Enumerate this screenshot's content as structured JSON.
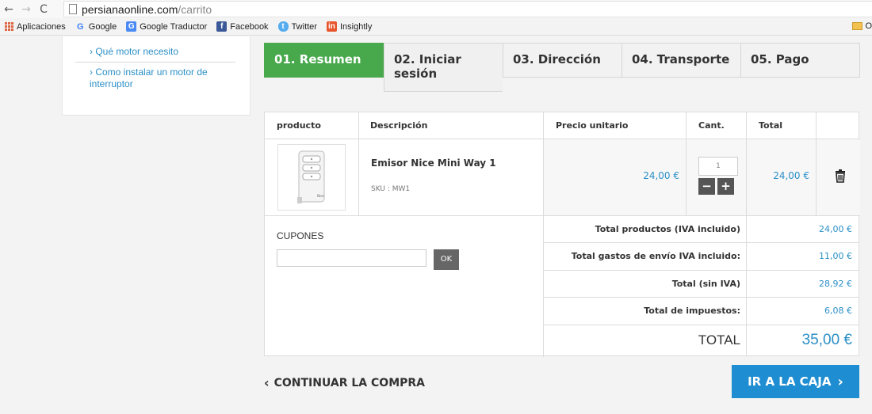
{
  "browser": {
    "url_host": "persianaonline.com",
    "url_path": "/carrito",
    "bookmarks": [
      "Aplicaciones",
      "Google",
      "Google Traductor",
      "Facebook",
      "Twitter",
      "Insightly"
    ],
    "bookmarks_folder": "O"
  },
  "sidebar": {
    "links": [
      "› Qué motor necesito",
      "› Como instalar un motor de interruptor"
    ]
  },
  "steps": [
    {
      "label": "01. Resumen",
      "active": true
    },
    {
      "label": "02. Iniciar sesión",
      "active": false
    },
    {
      "label": "03. Dirección",
      "active": false
    },
    {
      "label": "04. Transporte",
      "active": false
    },
    {
      "label": "05. Pago",
      "active": false
    }
  ],
  "cart": {
    "headers": {
      "product": "producto",
      "description": "Descripción",
      "unit_price": "Precio unitario",
      "qty": "Cant.",
      "total": "Total"
    },
    "item": {
      "name": "Emisor Nice Mini Way 1",
      "sku": "SKU : MW1",
      "unit_price": "24,00 €",
      "qty": "1",
      "total": "24,00 €"
    },
    "coupons": {
      "title": "CUPONES",
      "input_value": "",
      "button": "OK"
    },
    "totals": [
      {
        "label": "Total productos (IVA incluido)",
        "value": "24,00 €"
      },
      {
        "label": "Total gastos de envío IVA incluido:",
        "value": "11,00 €"
      },
      {
        "label": "Total (sin IVA)",
        "value": "28,92 €"
      },
      {
        "label": "Total de impuestos:",
        "value": "6,08 €"
      }
    ],
    "grand_total": {
      "label": "TOTAL",
      "value": "35,00 €"
    }
  },
  "actions": {
    "continue": "CONTINUAR LA COMPRA",
    "checkout": "IR A LA CAJA"
  },
  "colors": {
    "accent_green": "#47a84c",
    "accent_blue": "#1f8dd1",
    "link_blue": "#2b8fc7"
  }
}
